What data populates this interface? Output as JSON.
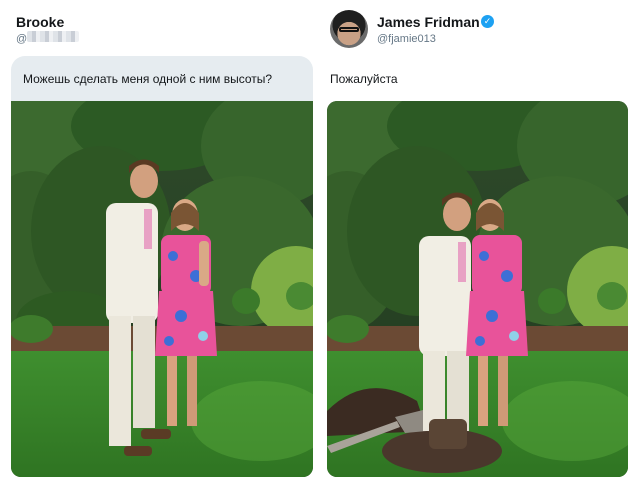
{
  "left_tweet": {
    "author_name": "Brooke",
    "handle": "@",
    "message": "Можешь сделать меня одной с ним высоты?"
  },
  "right_tweet": {
    "author_name": "James Fridman",
    "handle": "@fjamie013",
    "verified_icon": "verified-badge-icon",
    "message": "Пожалуйста"
  },
  "colors": {
    "bubble": "#e6ecf0",
    "verified": "#1da1f2",
    "handle": "#657786",
    "grass": "#3d8c2c",
    "dress_pink": "#e8539a",
    "suit": "#f1eee4"
  }
}
